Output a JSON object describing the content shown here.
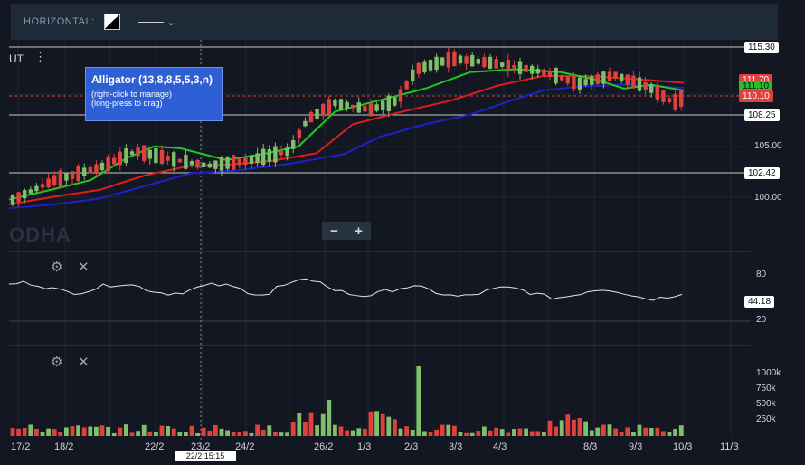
{
  "toolbar": {
    "label": "HORIZONTAL:",
    "dropdown_icon": "chevron-down-icon"
  },
  "symbol_label": "UT",
  "tooltip": {
    "title": "Alligator (13,8,8,5,5,3,n)",
    "line1": "(right-click to manage)",
    "line2": "(long-press to drag)"
  },
  "watermark": "ODHA",
  "zoom": {
    "minus": "−",
    "plus": "+"
  },
  "price_labels": {
    "h1": "115.30",
    "h2": "108.25",
    "h3": "102.42",
    "red": "111.70",
    "green": "111.10",
    "last": "110.10"
  },
  "price_axis": [
    "105.00",
    "100.00"
  ],
  "rsi": {
    "value": "44.18",
    "ticks": [
      "80",
      "20"
    ]
  },
  "volume_axis": [
    "1000k",
    "750k",
    "500k",
    "250k"
  ],
  "x_axis": [
    "17/2",
    "18/2",
    "22/2",
    "23/2",
    "24/2",
    "26/2",
    "1/3",
    "2/3",
    "3/3",
    "4/3",
    "8/3",
    "9/3",
    "10/3",
    "11/3"
  ],
  "crosshair_label": "22/2 15:15",
  "colors": {
    "bg": "#131722",
    "up": "#7fbf6a",
    "down": "#e0413c",
    "jaw": "#1f1fcc",
    "teeth": "#e01c1c",
    "lips": "#1ec81e"
  }
}
